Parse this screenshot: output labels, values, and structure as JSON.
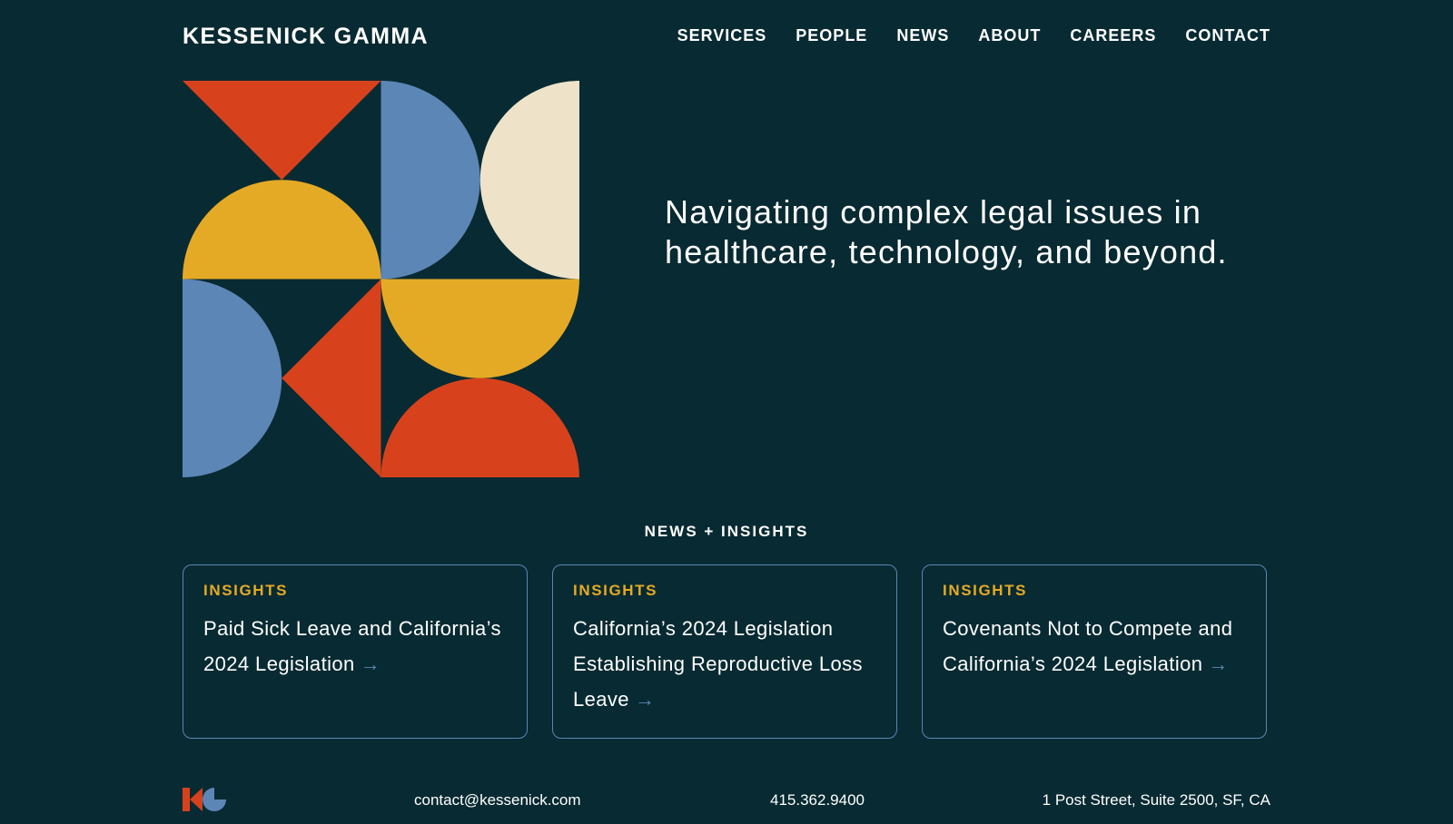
{
  "header": {
    "logo_text": "KESSENICK GAMMA",
    "nav": [
      {
        "label": "SERVICES"
      },
      {
        "label": "PEOPLE"
      },
      {
        "label": "NEWS"
      },
      {
        "label": "ABOUT"
      },
      {
        "label": "CAREERS"
      },
      {
        "label": "CONTACT"
      }
    ]
  },
  "hero": {
    "headline": "Navigating complex legal issues in healthcare, technology, and beyond."
  },
  "news": {
    "section_title": "NEWS + INSIGHTS",
    "cards": [
      {
        "tag": "INSIGHTS",
        "title": "Paid Sick Leave and California’s 2024 Legislation",
        "arrow": "→"
      },
      {
        "tag": "INSIGHTS",
        "title": "California’s 2024 Legislation Establishing Reproductive Loss Leave",
        "arrow": "→"
      },
      {
        "tag": "INSIGHTS",
        "title": "Covenants Not to Compete and California’s 2024 Legislation",
        "arrow": "→"
      }
    ]
  },
  "footer": {
    "email": "contact@kessenick.com",
    "phone": "415.362.9400",
    "address": "1 Post Street, Suite 2500, SF, CA"
  },
  "colors": {
    "background": "#082a32",
    "orange": "#d7421d",
    "blue": "#5b86b6",
    "yellow": "#e5aa25",
    "cream": "#eee3c8",
    "text": "#ffffff"
  }
}
